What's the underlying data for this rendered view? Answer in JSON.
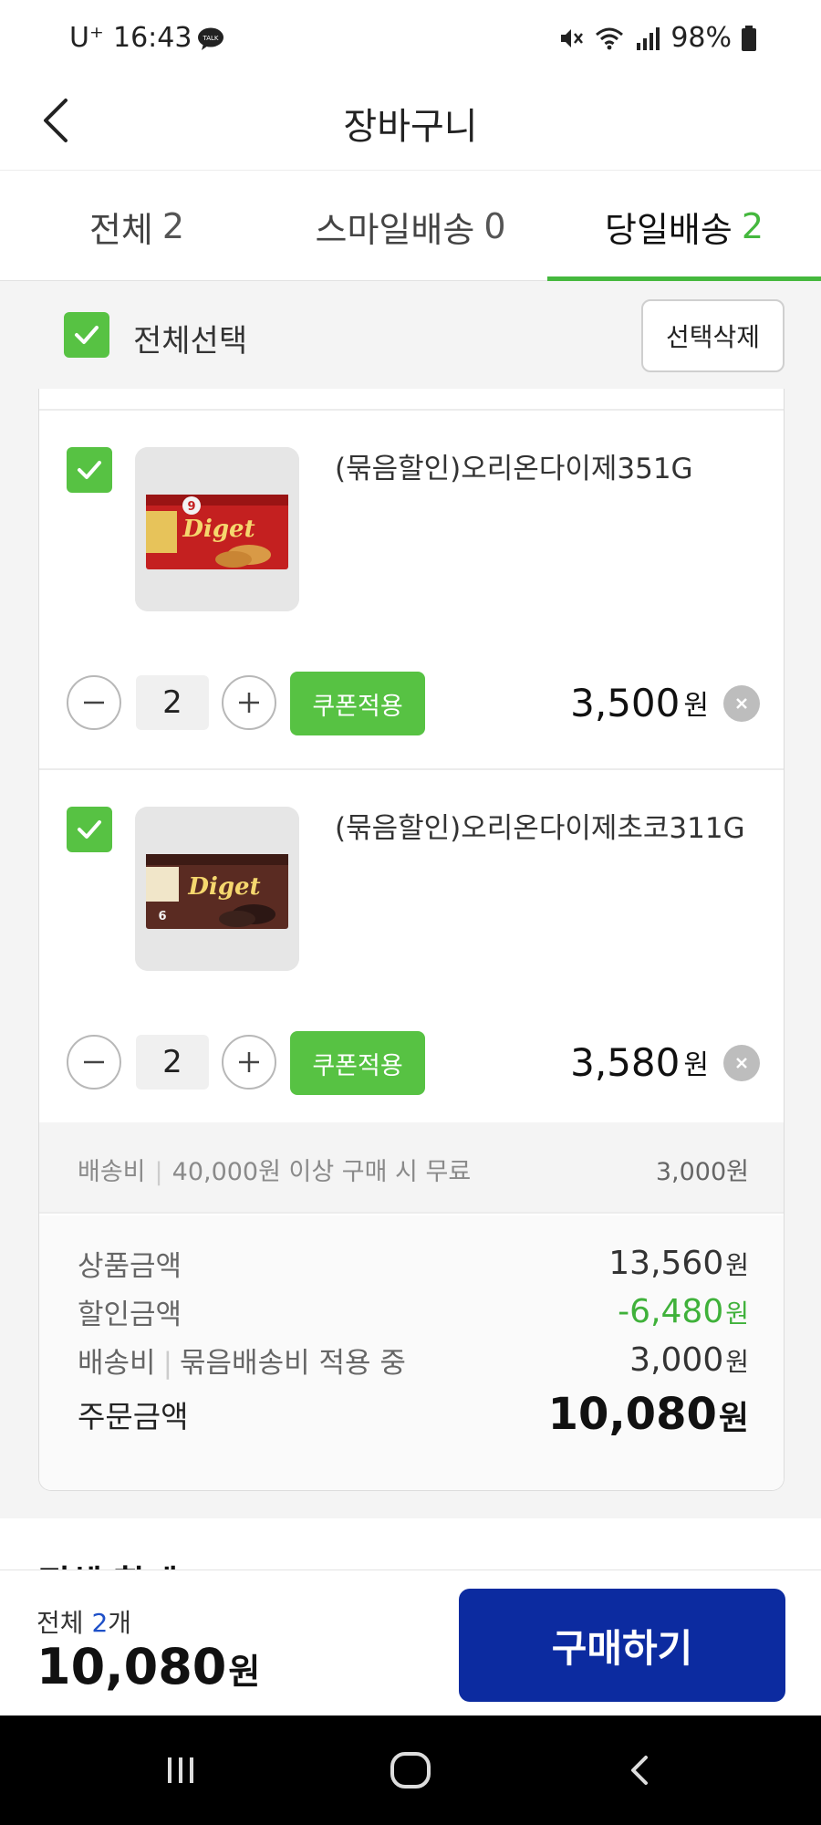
{
  "status_bar": {
    "carrier": "U⁺",
    "time": "16:43",
    "talk_badge": "TALK",
    "battery": "98%"
  },
  "header": {
    "title": "장바구니"
  },
  "tabs": [
    {
      "label": "전체",
      "count": "2"
    },
    {
      "label": "스마일배송",
      "count": "0"
    },
    {
      "label": "당일배송",
      "count": "2",
      "active": true
    }
  ],
  "select_bar": {
    "select_all_label": "전체선택",
    "delete_selected_label": "선택삭제"
  },
  "items": [
    {
      "name": "(묶음할인)오리온다이제351G",
      "quantity": "2",
      "coupon_label": "쿠폰적용",
      "price": "3,500",
      "unit": "원",
      "thumb_brand": "Diget",
      "thumb_badge": "9"
    },
    {
      "name": "(묶음할인)오리온다이제초코311G",
      "quantity": "2",
      "coupon_label": "쿠폰적용",
      "price": "3,580",
      "unit": "원",
      "thumb_brand": "Diget",
      "thumb_badge": "6"
    }
  ],
  "shipping": {
    "label": "배송비",
    "condition": "40,000원 이상 구매 시 무료",
    "fee": "3,000원"
  },
  "summary": {
    "product_amount_label": "상품금액",
    "product_amount": "13,560",
    "discount_label": "할인금액",
    "discount": "-6,480",
    "shipping_label": "배송비",
    "shipping_note": "묶음배송비 적용 중",
    "shipping": "3,000",
    "order_amount_label": "주문금액",
    "order_amount": "10,080",
    "unit": "원"
  },
  "section_peek": {
    "title": "전체 합계"
  },
  "bottom_bar": {
    "total_prefix": "전체",
    "total_count": "2",
    "total_suffix": "개",
    "total_price": "10,080",
    "unit": "원",
    "buy_label": "구매하기"
  },
  "colors": {
    "accent_green": "#57c243",
    "tab_count_green": "#45b83e",
    "discount_green": "#3fb13a",
    "buy_button_blue": "#0c2ba0",
    "count_blue": "#1e50c8"
  },
  "icons": {
    "back": "chevron-left-icon",
    "checkbox": "check-icon",
    "minus": "minus-icon",
    "plus": "plus-icon",
    "remove": "close-icon",
    "nav_recents": "recents-icon",
    "nav_home": "home-icon",
    "nav_back": "nav-back-icon"
  }
}
